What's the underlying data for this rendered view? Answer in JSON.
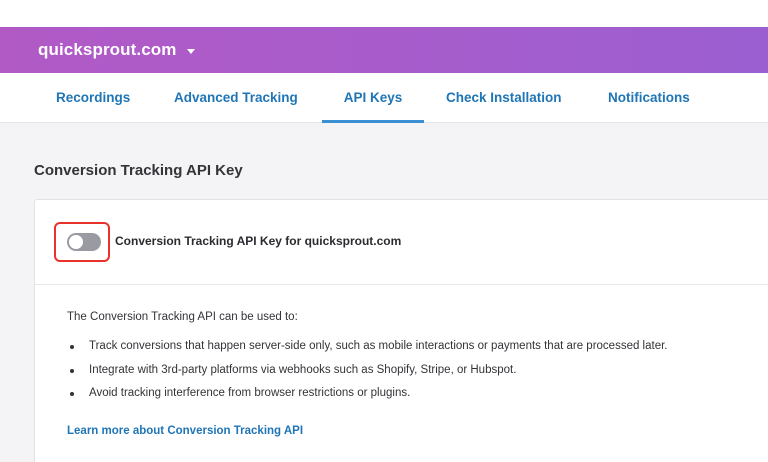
{
  "header": {
    "site_name": "quicksprout.com"
  },
  "tabs": [
    {
      "label": "Recordings",
      "active": false
    },
    {
      "label": "Advanced Tracking",
      "active": false
    },
    {
      "label": "API Keys",
      "active": true
    },
    {
      "label": "Check Installation",
      "active": false
    },
    {
      "label": "Notifications",
      "active": false
    }
  ],
  "section": {
    "title": "Conversion Tracking API Key"
  },
  "card": {
    "toggle_label": "Conversion Tracking API Key for quicksprout.com",
    "toggle_on": false,
    "description": "The Conversion Tracking API can be used to:",
    "bullets": [
      "Track conversions that happen server-side only, such as mobile interactions or payments that are processed later.",
      "Integrate with 3rd-party platforms via webhooks such as Shopify, Stripe, or Hubspot.",
      "Avoid tracking interference from browser restrictions or plugins."
    ],
    "learn_more": "Learn more about Conversion Tracking API"
  },
  "colors": {
    "header_gradient_start": "#b15ac6",
    "header_gradient_end": "#9b5fd1",
    "link_blue": "#1f75b5",
    "highlight_red": "#e8322b",
    "toggle_off": "#9a9aa3"
  }
}
